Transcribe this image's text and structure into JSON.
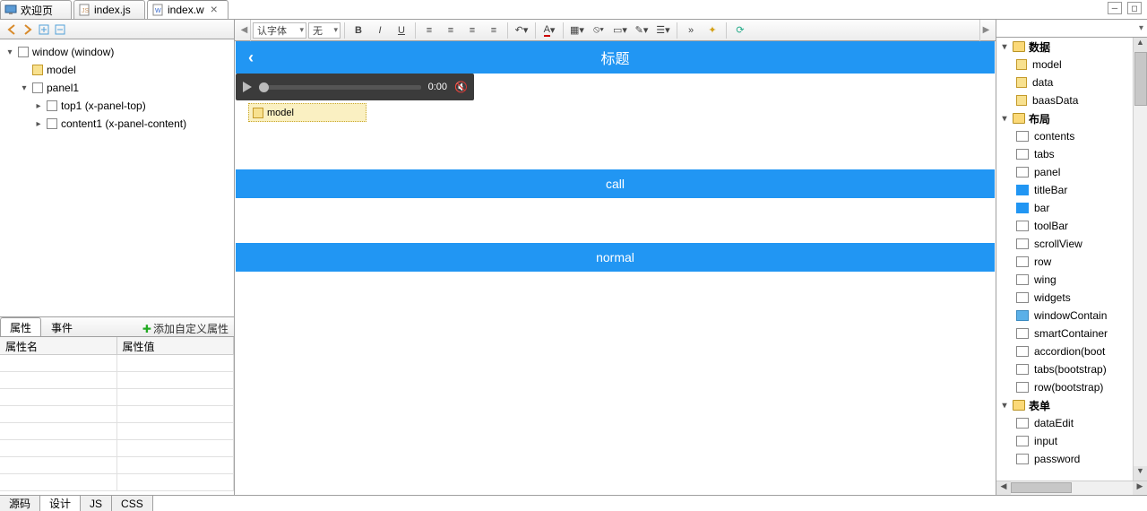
{
  "editor_tabs": [
    {
      "label": "欢迎页",
      "closable": true,
      "active": false
    },
    {
      "label": "index.js",
      "closable": true,
      "active": false
    },
    {
      "label": "index.w",
      "closable": true,
      "active": true
    }
  ],
  "outline": {
    "root": {
      "label": "window (window)"
    },
    "model": {
      "label": "model"
    },
    "panel1": {
      "label": "panel1"
    },
    "top1": {
      "label": "top1 (x-panel-top)"
    },
    "content1": {
      "label": "content1 (x-panel-content)"
    }
  },
  "properties": {
    "tab_attr": "属性",
    "tab_event": "事件",
    "add_custom": "添加自定义属性",
    "col_name": "属性名",
    "col_value": "属性值"
  },
  "rte": {
    "font": "认字体",
    "size": "无"
  },
  "canvas": {
    "title": "标题",
    "audio_time": "0:00",
    "model_badge": "model",
    "btn1": "call",
    "btn2": "normal"
  },
  "palette": {
    "cat_data": "数据",
    "data_items": [
      "model",
      "data",
      "baasData"
    ],
    "cat_layout": "布局",
    "layout_items": [
      "contents",
      "tabs",
      "panel",
      "titleBar",
      "bar",
      "toolBar",
      "scrollView",
      "row",
      "wing",
      "widgets",
      "windowContain",
      "smartContainer",
      "accordion(boot",
      "tabs(bootstrap)",
      "row(bootstrap)"
    ],
    "cat_form": "表单",
    "form_items": [
      "dataEdit",
      "input",
      "password"
    ]
  },
  "bottom_tabs": [
    "源码",
    "设计",
    "JS",
    "CSS"
  ],
  "bottom_active": 1
}
